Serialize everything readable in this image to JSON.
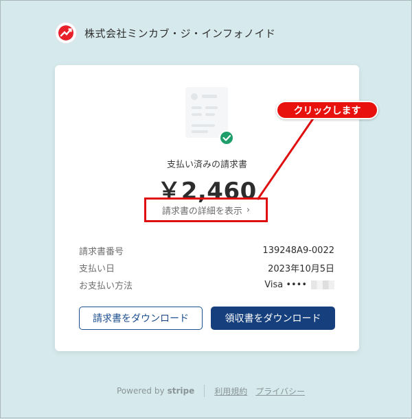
{
  "header": {
    "company_name": "株式会社ミンカブ・ジ・インフォノイド",
    "logo_icon": "minkabu-logo-icon"
  },
  "card": {
    "subtitle": "支払い済みの請求書",
    "amount": "￥2,460",
    "detail_link": "請求書の詳細を表示",
    "details": [
      {
        "label": "請求書番号",
        "value": "139248A9-0022"
      },
      {
        "label": "支払い日",
        "value": "2023年10月5日"
      },
      {
        "label": "お支払い方法",
        "value": "Visa •••• "
      }
    ],
    "download_invoice": "請求書をダウンロード",
    "download_receipt": "領収書をダウンロード"
  },
  "annotation": {
    "callout_text": "クリックします",
    "color": "#e8110e"
  },
  "footer": {
    "powered_by": "Powered by",
    "brand": "stripe",
    "terms": "利用規約",
    "privacy": "プライバシー"
  },
  "colors": {
    "background": "#d6e9ec",
    "primary": "#163f7d",
    "check": "#1e9e6a"
  }
}
